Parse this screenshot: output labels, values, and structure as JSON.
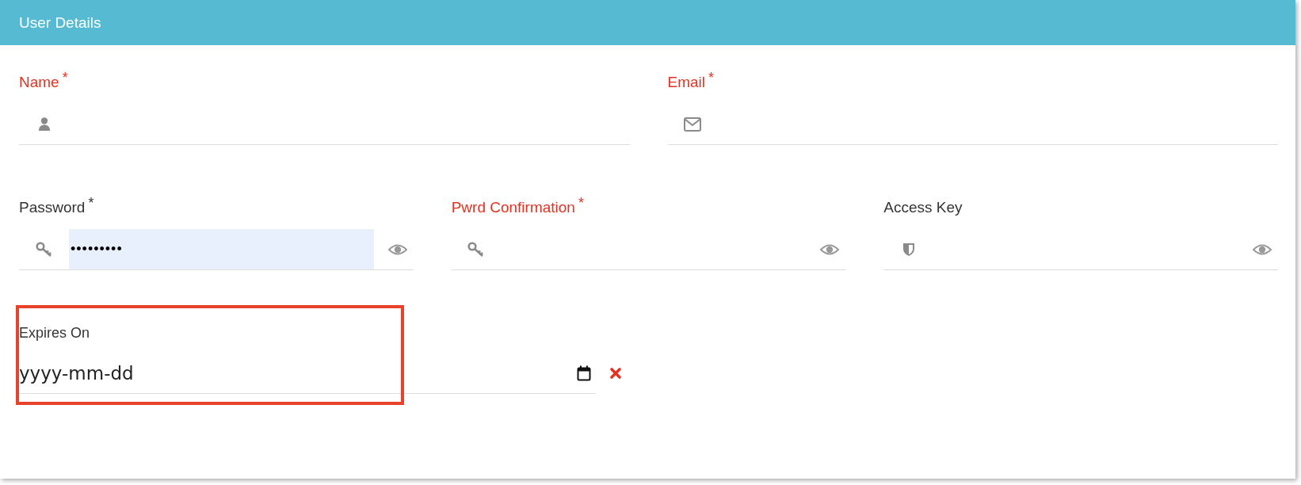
{
  "panel": {
    "title": "User Details"
  },
  "rows": [
    {
      "fields": [
        {
          "kind": "text",
          "label": "Name",
          "marker": "*",
          "invalid": true
        },
        {
          "kind": "email",
          "label": "Email",
          "marker": "*",
          "invalid": true
        }
      ]
    },
    {
      "fields": [
        {
          "kind": "password",
          "label": "Password",
          "marker": "*",
          "invalid": false,
          "value": "•••••••••",
          "autofilled": true
        },
        {
          "kind": "password",
          "label": "Pwrd Confirmation",
          "marker": "*",
          "invalid": true,
          "autofilled": false
        },
        {
          "kind": "secret",
          "label": "Access Key",
          "invalid": false,
          "autofilled": false
        }
      ]
    },
    {
      "fields": [
        {
          "kind": "date",
          "label": "Expires On",
          "invalid": false,
          "placeholder": "yyyy-mm-dd",
          "highlighted": true
        }
      ]
    }
  ]
}
